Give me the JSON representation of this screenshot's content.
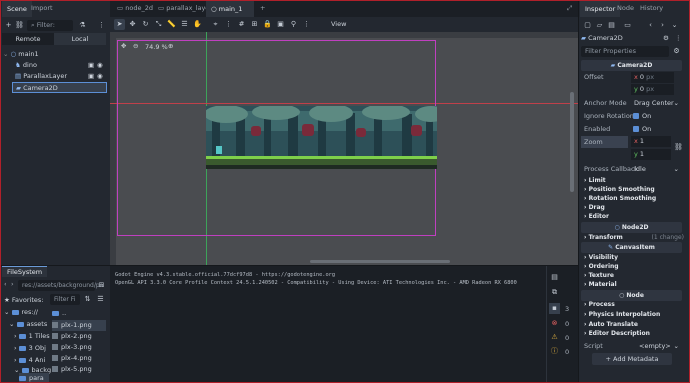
{
  "scene_panel": {
    "tabs": [
      "Scene",
      "Import"
    ],
    "filter_placeholder": "Filter: name, t:t",
    "mode_tabs": [
      "Remote",
      "Local"
    ],
    "nodes": [
      {
        "label": "main1",
        "depth": 0
      },
      {
        "label": "dino",
        "depth": 1
      },
      {
        "label": "ParallaxLayer",
        "depth": 1
      },
      {
        "label": "Camera2D",
        "depth": 1
      }
    ]
  },
  "editor_tabs": [
    "node_2d",
    "parallax_layer",
    "main_1"
  ],
  "toolbar": {
    "view_label": "View"
  },
  "viewport": {
    "zoom_label": "74.9 %"
  },
  "filesystem": {
    "tab": "FileSystem",
    "path": "res://assets/background/pa",
    "favorites_label": "Favorites:",
    "filter_placeholder": "Filter Fi",
    "tree": [
      {
        "label": "res://",
        "depth": 0
      },
      {
        "label": "assets",
        "depth": 1
      },
      {
        "label": "1 Tiles",
        "depth": 2
      },
      {
        "label": "3 Obj",
        "depth": 2
      },
      {
        "label": "4 Ani",
        "depth": 2
      },
      {
        "label": "backg",
        "depth": 2
      },
      {
        "label": "para",
        "depth": 3
      }
    ],
    "files": [
      "..",
      "plx-1.png",
      "plx-2.png",
      "plx-3.png",
      "plx-4.png",
      "plx-5.png"
    ]
  },
  "console": {
    "lines": [
      "Godot Engine v4.3.stable.official.77dcf97d8 - https://godotengine.org",
      "OpenGL API 3.3.0 Core Profile Context 24.5.1.240502 - Compatibility - Using Device: ATI Technologies Inc. - AMD Radeon RX 6800"
    ],
    "counts": [
      "3",
      "0",
      "0",
      "0"
    ]
  },
  "inspector": {
    "tabs": [
      "Inspector",
      "Node",
      "History"
    ],
    "object_name": "Camera2D",
    "filter_placeholder": "Filter Properties",
    "class_header": "Camera2D",
    "props": {
      "offset_label": "Offset",
      "offset_x": "0",
      "offset_y": "0",
      "unit": "px",
      "anchor_label": "Anchor Mode",
      "anchor_value": "Drag Center",
      "ignore_rot_label": "Ignore Rotation",
      "ignore_rot_value": "On",
      "enabled_label": "Enabled",
      "enabled_value": "On",
      "zoom_label": "Zoom",
      "zoom_x": "1",
      "zoom_y": "1",
      "callback_label": "Process Callback",
      "callback_value": "Idle"
    },
    "sections_a": [
      "Limit",
      "Position Smoothing",
      "Rotation Smoothing",
      "Drag",
      "Editor"
    ],
    "node2d_header": "Node2D",
    "transform_label": "Transform",
    "transform_change": "(1 change)",
    "canvas_header": "CanvasItem",
    "sections_b": [
      "Visibility",
      "Ordering",
      "Texture",
      "Material"
    ],
    "node_header": "Node",
    "sections_c": [
      "Process",
      "Physics Interpolation",
      "Auto Translate",
      "Editor Description"
    ],
    "script_label": "Script",
    "script_value": "<empty>",
    "add_metadata": "Add Metadata"
  },
  "colors": {
    "accent": "#5c8fd6",
    "camera_frame": "#c040c0",
    "axis_red": "#c0404a"
  }
}
